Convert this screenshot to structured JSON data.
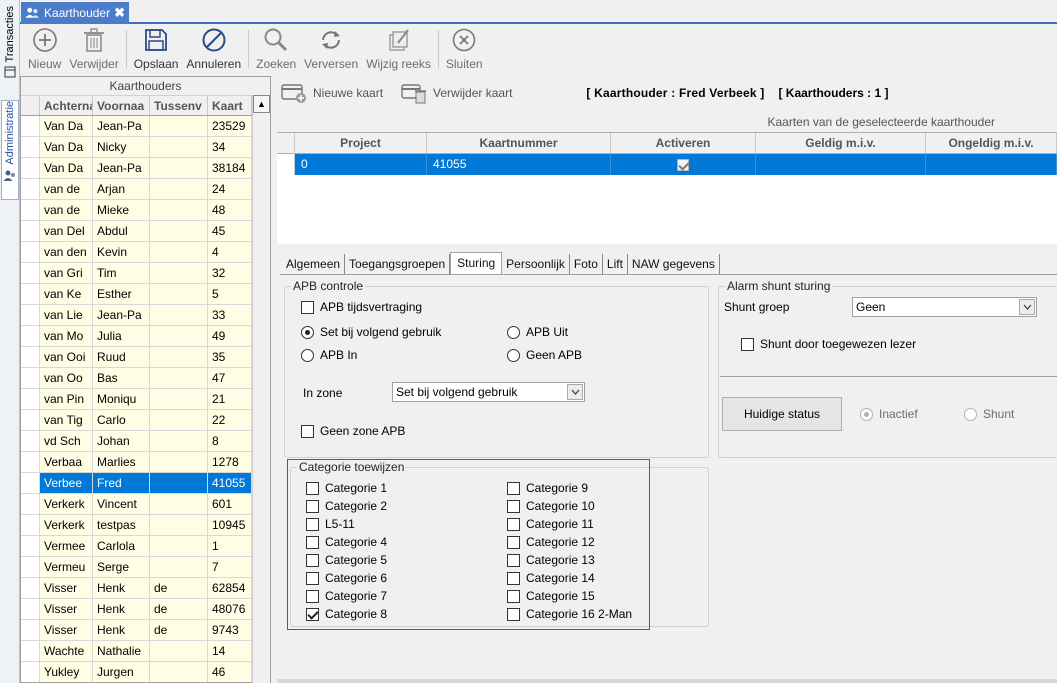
{
  "sidebar": {
    "tabs": [
      {
        "label": "Transacties",
        "icon": "transactions-icon"
      },
      {
        "label": "Administratie",
        "icon": "users-icon"
      }
    ]
  },
  "doc_tab": {
    "label": "Kaarthouder",
    "close": "✖"
  },
  "toolbar": {
    "buttons": [
      {
        "label": "Nieuw",
        "icon": "add-circle-icon"
      },
      {
        "label": "Verwijder",
        "icon": "trash-icon"
      },
      {
        "label": "Opslaan",
        "icon": "save-icon"
      },
      {
        "label": "Annuleren",
        "icon": "cancel-icon"
      },
      {
        "label": "Zoeken",
        "icon": "search-icon"
      },
      {
        "label": "Verversen",
        "icon": "refresh-icon"
      },
      {
        "label": "Wijzig reeks",
        "icon": "edit-series-icon"
      },
      {
        "label": "Sluiten",
        "icon": "close-circle-icon"
      }
    ]
  },
  "cardholders": {
    "title": "Kaarthouders",
    "columns": [
      "Achternaa",
      "Voornaa",
      "Tussenv",
      "Kaart"
    ],
    "rows": [
      {
        "last": "Van Da",
        "first": "Jean-Pa",
        "infix": "",
        "card": "23529"
      },
      {
        "last": "Van Da",
        "first": "Nicky",
        "infix": "",
        "card": "34"
      },
      {
        "last": "Van Da",
        "first": "Jean-Pa",
        "infix": "",
        "card": "38184"
      },
      {
        "last": "van de",
        "first": "Arjan",
        "infix": "",
        "card": "24"
      },
      {
        "last": "van de",
        "first": "Mieke",
        "infix": "",
        "card": "48"
      },
      {
        "last": "van Del",
        "first": "Abdul",
        "infix": "",
        "card": "45"
      },
      {
        "last": "van den",
        "first": "Kevin",
        "infix": "",
        "card": "4"
      },
      {
        "last": "van Gri",
        "first": "Tim",
        "infix": "",
        "card": "32"
      },
      {
        "last": "van Ke",
        "first": "Esther",
        "infix": "",
        "card": "5"
      },
      {
        "last": "van Lie",
        "first": "Jean-Pa",
        "infix": "",
        "card": "33"
      },
      {
        "last": "van Mo",
        "first": "Julia",
        "infix": "",
        "card": "49"
      },
      {
        "last": "van Ooi",
        "first": "Ruud",
        "infix": "",
        "card": "35"
      },
      {
        "last": "van Oo",
        "first": "Bas",
        "infix": "",
        "card": "47"
      },
      {
        "last": "van Pin",
        "first": "Moniqu",
        "infix": "",
        "card": "21"
      },
      {
        "last": "van Tig",
        "first": "Carlo",
        "infix": "",
        "card": "22"
      },
      {
        "last": "vd Sch",
        "first": "Johan",
        "infix": "",
        "card": "8"
      },
      {
        "last": "Verbaa",
        "first": "Marlies",
        "infix": "",
        "card": "1278"
      },
      {
        "last": "Verbee",
        "first": "Fred",
        "infix": "",
        "card": "41055",
        "selected": true
      },
      {
        "last": "Verkerk",
        "first": "Vincent",
        "infix": "",
        "card": "601"
      },
      {
        "last": "Verkerk",
        "first": "testpas",
        "infix": "",
        "card": "10945"
      },
      {
        "last": "Vermee",
        "first": "Carlola",
        "infix": "",
        "card": "1"
      },
      {
        "last": "Vermeu",
        "first": "Serge",
        "infix": "",
        "card": "7"
      },
      {
        "last": "Visser",
        "first": "Henk",
        "infix": "de",
        "card": "62854"
      },
      {
        "last": "Visser",
        "first": "Henk",
        "infix": "de",
        "card": "48076"
      },
      {
        "last": "Visser",
        "first": "Henk",
        "infix": "de",
        "card": "9743"
      },
      {
        "last": "Wachte",
        "first": "Nathalie",
        "infix": "",
        "card": "14"
      },
      {
        "last": "Yukley",
        "first": "Jurgen",
        "infix": "",
        "card": "46"
      }
    ]
  },
  "card_actions": {
    "new_card": "Nieuwe kaart",
    "delete_card": "Verwijder kaart",
    "holder_info": "[ Kaarthouder  :  Fred Verbeek  ]",
    "holder_count": "[ Kaarthouders  :  1 ]"
  },
  "cards": {
    "title": "Kaarten van de geselecteerde kaarthouder",
    "columns": [
      "Project",
      "Kaartnummer",
      "Activeren",
      "Geldig m.i.v.",
      "Ongeldig m.i.v."
    ],
    "rows": [
      {
        "project": "0",
        "number": "41055",
        "active": true,
        "valid_from": "",
        "invalid_from": ""
      }
    ]
  },
  "detail_tabs": [
    "Algemeen",
    "Toegangsgroepen",
    "Sturing",
    "Persoonlijk",
    "Foto",
    "Lift",
    "NAW gegevens"
  ],
  "detail_active_tab": "Sturing",
  "apb": {
    "title": "APB controle",
    "delay_label": "APB tijdsvertraging",
    "delay_checked": false,
    "radios": [
      {
        "label": "Set bij volgend gebruik",
        "checked": true
      },
      {
        "label": "APB Uit",
        "checked": false
      },
      {
        "label": "APB In",
        "checked": false
      },
      {
        "label": "Geen APB",
        "checked": false
      }
    ],
    "zone_label": "In zone",
    "zone_value": "Set bij volgend gebruik",
    "no_zone_label": "Geen zone APB",
    "no_zone_checked": false
  },
  "alarm": {
    "title": "Alarm shunt sturing",
    "group_label": "Shunt groep",
    "group_value": "Geen",
    "shunt_reader_label": "Shunt door toegewezen lezer",
    "shunt_reader_checked": false,
    "status_button": "Huidige status",
    "status_radios": [
      {
        "label": "Inactief",
        "checked": true
      },
      {
        "label": "Shunt",
        "checked": false
      }
    ]
  },
  "categories": {
    "title": "Categorie toewijzen",
    "items": [
      {
        "label": "Categorie 1",
        "checked": false
      },
      {
        "label": "Categorie 2",
        "checked": false
      },
      {
        "label": "L5-11",
        "checked": false
      },
      {
        "label": "Categorie 4",
        "checked": false
      },
      {
        "label": "Categorie 5",
        "checked": false
      },
      {
        "label": "Categorie 6",
        "checked": false
      },
      {
        "label": "Categorie 7",
        "checked": false
      },
      {
        "label": "Categorie 8",
        "checked": true
      },
      {
        "label": "Categorie 9",
        "checked": false
      },
      {
        "label": "Categorie 10",
        "checked": false
      },
      {
        "label": "Categorie 11",
        "checked": false
      },
      {
        "label": "Categorie 12",
        "checked": false
      },
      {
        "label": "Categorie 13",
        "checked": false
      },
      {
        "label": "Categorie 14",
        "checked": false
      },
      {
        "label": "Categorie 15",
        "checked": false
      },
      {
        "label": "Categorie 16 2-Man",
        "checked": false
      }
    ]
  },
  "colors": {
    "selection": "#0078d7",
    "doc_tab": "#4a7cc9",
    "row_highlight": "#fffde4",
    "highlight_frame": "#d9262b"
  }
}
